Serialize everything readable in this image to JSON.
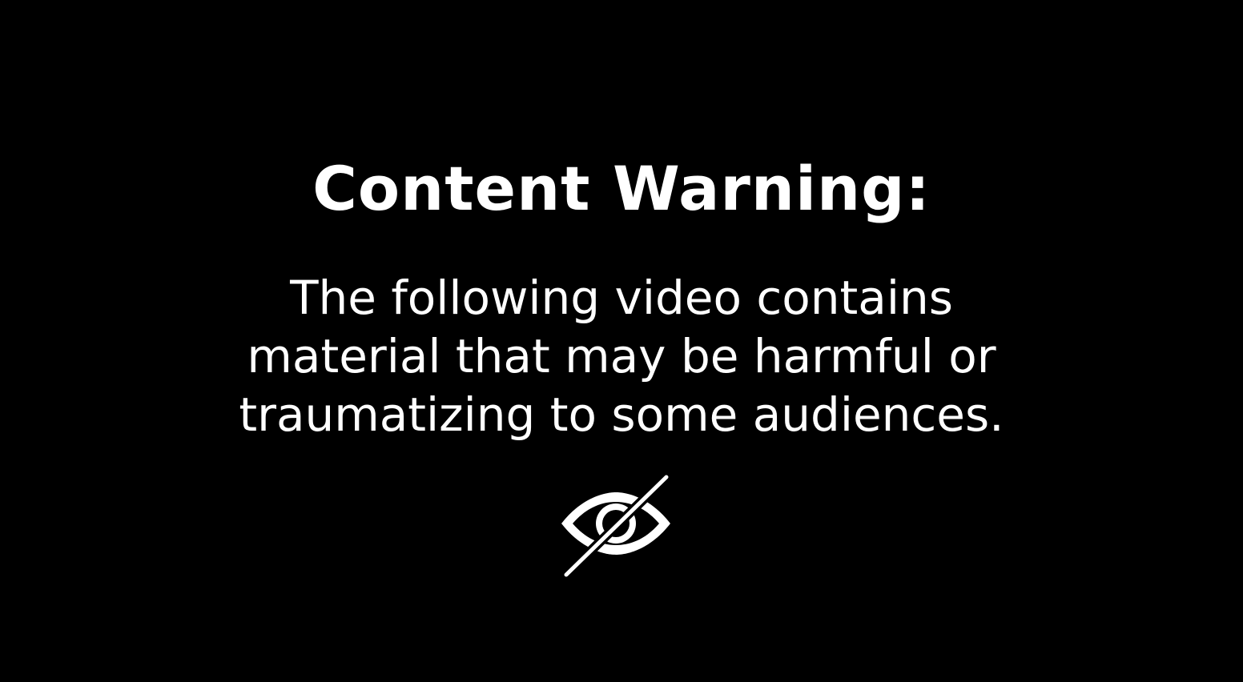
{
  "warning": {
    "title": "Content Warning:",
    "lines": [
      "The following video contains",
      "material that may be harmful or",
      "traumatizing to some audiences."
    ],
    "icon": "eye-slash-icon"
  },
  "colors": {
    "background": "#000000",
    "text": "#ffffff"
  }
}
